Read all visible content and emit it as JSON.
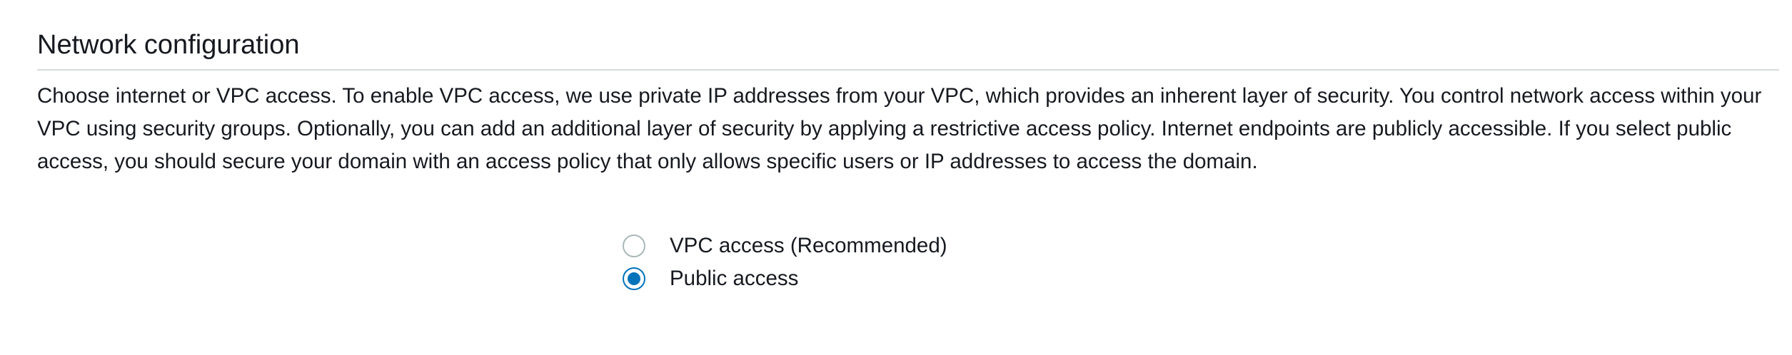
{
  "network_config": {
    "title": "Network configuration",
    "description": "Choose internet or VPC access. To enable VPC access, we use private IP addresses from your VPC, which provides an inherent layer of security. You control network access within your VPC using security groups. Optionally, you can add an additional layer of security by applying a restrictive access policy. Internet endpoints are publicly accessible. If you select public access, you should secure your domain with an access policy that only allows specific users or IP addresses to access the domain.",
    "options": [
      {
        "label": "VPC access (Recommended)",
        "selected": false
      },
      {
        "label": "Public access",
        "selected": true
      }
    ]
  },
  "colors": {
    "accent": "#0073bb",
    "text": "#16191f",
    "divider": "#d5dbdb",
    "radio_border": "#aab7b8"
  }
}
